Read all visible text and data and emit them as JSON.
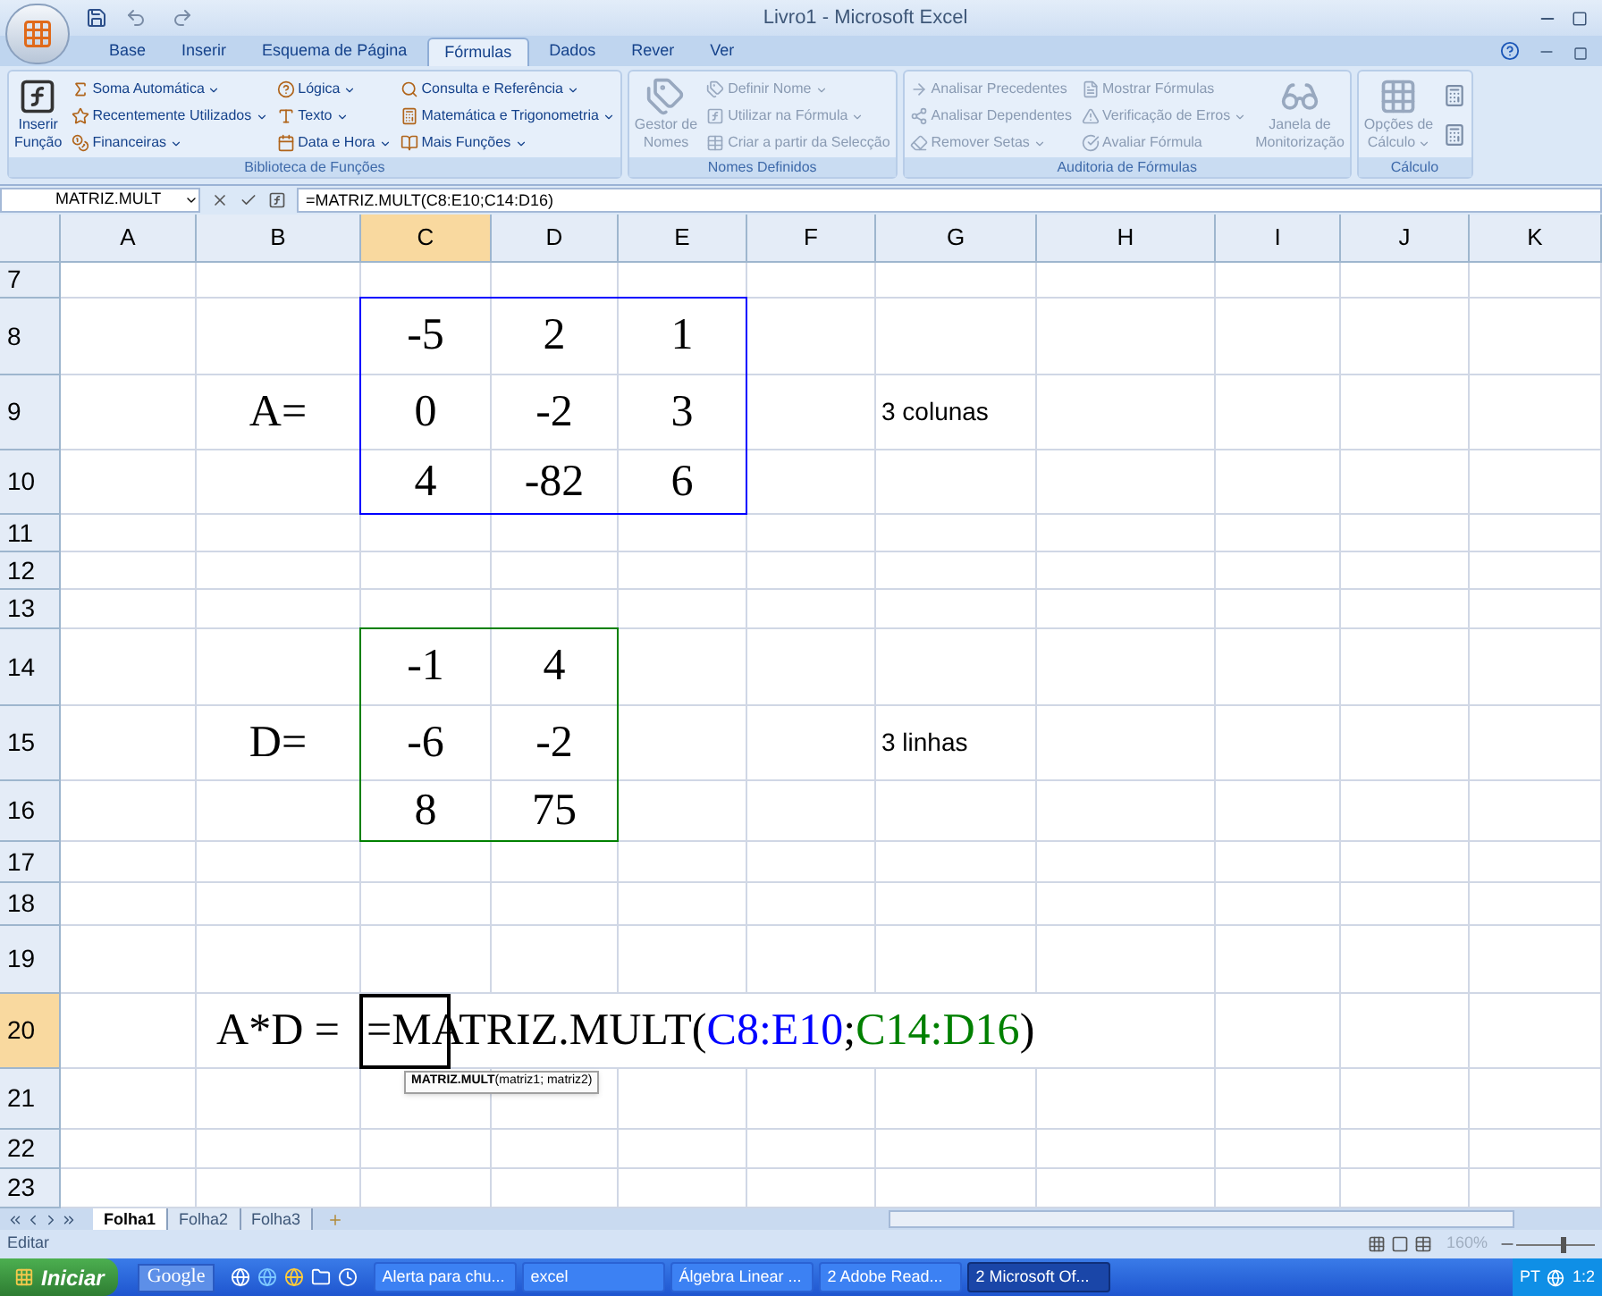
{
  "window": {
    "title": "Livro1 - Microsoft Excel"
  },
  "ribbon_tabs": [
    {
      "label": "Base",
      "selected": false
    },
    {
      "label": "Inserir",
      "selected": false
    },
    {
      "label": "Esquema de Página",
      "selected": false
    },
    {
      "label": "Fórmulas",
      "selected": true
    },
    {
      "label": "Dados",
      "selected": false
    },
    {
      "label": "Rever",
      "selected": false
    },
    {
      "label": "Ver",
      "selected": false
    }
  ],
  "ribbon_groups": [
    {
      "label": "Biblioteca de Funções",
      "disabled": false,
      "columns": [
        [
          {
            "kind": "large",
            "lines": [
              "Inserir",
              "Função"
            ],
            "dropdown": false
          }
        ],
        [
          {
            "kind": "small",
            "label": "Soma Automática",
            "dropdown": true
          },
          {
            "kind": "small",
            "label": "Recentemente Utilizados",
            "dropdown": true
          },
          {
            "kind": "small",
            "label": "Financeiras",
            "dropdown": true
          }
        ],
        [
          {
            "kind": "small",
            "label": "Lógica",
            "dropdown": true
          },
          {
            "kind": "small",
            "label": "Texto",
            "dropdown": true
          },
          {
            "kind": "small",
            "label": "Data e Hora",
            "dropdown": true
          }
        ],
        [
          {
            "kind": "small",
            "label": "Consulta e Referência",
            "dropdown": true
          },
          {
            "kind": "small",
            "label": "Matemática e Trigonometria",
            "dropdown": true
          },
          {
            "kind": "small",
            "label": "Mais Funções",
            "dropdown": true
          }
        ]
      ]
    },
    {
      "label": "Nomes Definidos",
      "disabled": true,
      "columns": [
        [
          {
            "kind": "large",
            "lines": [
              "Gestor de",
              "Nomes"
            ],
            "dropdown": false
          }
        ],
        [
          {
            "kind": "small",
            "label": "Definir Nome",
            "dropdown": true
          },
          {
            "kind": "small",
            "label": "Utilizar na Fórmula",
            "dropdown": true
          },
          {
            "kind": "small",
            "label": "Criar a partir da Selecção",
            "dropdown": false
          }
        ]
      ]
    },
    {
      "label": "Auditoria de Fórmulas",
      "disabled": true,
      "columns": [
        [
          {
            "kind": "small",
            "label": "Analisar Precedentes",
            "dropdown": false
          },
          {
            "kind": "small",
            "label": "Analisar Dependentes",
            "dropdown": false
          },
          {
            "kind": "small",
            "label": "Remover Setas",
            "dropdown": true
          }
        ],
        [
          {
            "kind": "small",
            "label": "Mostrar Fórmulas",
            "dropdown": false
          },
          {
            "kind": "small",
            "label": "Verificação de Erros",
            "dropdown": true
          },
          {
            "kind": "small",
            "label": "Avaliar Fórmula",
            "dropdown": false
          }
        ],
        [
          {
            "kind": "large",
            "lines": [
              "Janela de",
              "Monitorização"
            ],
            "dropdown": false
          }
        ]
      ]
    },
    {
      "label": "Cálculo",
      "disabled": true,
      "columns": [
        [
          {
            "kind": "large",
            "lines": [
              "Opções de",
              "Cálculo"
            ],
            "dropdown": true
          }
        ],
        [
          {
            "kind": "icon"
          },
          {
            "kind": "icon"
          }
        ]
      ]
    }
  ],
  "formula_bar": {
    "name_box": "MATRIZ.MULT",
    "formula": "=MATRIZ.MULT(C8:E10;C14:D16)"
  },
  "columns": [
    {
      "label": "A",
      "selected": false
    },
    {
      "label": "B",
      "selected": false
    },
    {
      "label": "C",
      "selected": true
    },
    {
      "label": "D",
      "selected": false
    },
    {
      "label": "E",
      "selected": false
    },
    {
      "label": "F",
      "selected": false
    },
    {
      "label": "G",
      "selected": false
    },
    {
      "label": "H",
      "selected": false
    },
    {
      "label": "I",
      "selected": false
    },
    {
      "label": "J",
      "selected": false
    },
    {
      "label": "K",
      "selected": false
    }
  ],
  "rows": [
    {
      "label": "7",
      "selected": false,
      "cells": {}
    },
    {
      "label": "8",
      "selected": false,
      "cells": {
        "C": {
          "text": "-5",
          "kind": "math"
        },
        "D": {
          "text": "2",
          "kind": "math"
        },
        "E": {
          "text": "1",
          "kind": "math"
        }
      }
    },
    {
      "label": "9",
      "selected": false,
      "cells": {
        "B": {
          "text": "A=",
          "kind": "math"
        },
        "C": {
          "text": "0",
          "kind": "math"
        },
        "D": {
          "text": "-2",
          "kind": "math"
        },
        "E": {
          "text": "3",
          "kind": "math"
        },
        "G": {
          "text": "3 colunas",
          "kind": "note"
        }
      }
    },
    {
      "label": "10",
      "selected": false,
      "cells": {
        "C": {
          "text": "4",
          "kind": "math"
        },
        "D": {
          "text": "-82",
          "kind": "math"
        },
        "E": {
          "text": "6",
          "kind": "math"
        }
      }
    },
    {
      "label": "11",
      "selected": false,
      "cells": {}
    },
    {
      "label": "12",
      "selected": false,
      "cells": {}
    },
    {
      "label": "13",
      "selected": false,
      "cells": {}
    },
    {
      "label": "14",
      "selected": false,
      "cells": {
        "C": {
          "text": "-1",
          "kind": "math"
        },
        "D": {
          "text": "4",
          "kind": "math"
        }
      }
    },
    {
      "label": "15",
      "selected": false,
      "cells": {
        "B": {
          "text": "D=",
          "kind": "math"
        },
        "C": {
          "text": "-6",
          "kind": "math"
        },
        "D": {
          "text": "-2",
          "kind": "math"
        },
        "G": {
          "text": "3 linhas",
          "kind": "note"
        }
      }
    },
    {
      "label": "16",
      "selected": false,
      "cells": {
        "C": {
          "text": "8",
          "kind": "math"
        },
        "D": {
          "text": "75",
          "kind": "math"
        }
      }
    },
    {
      "label": "17",
      "selected": false,
      "cells": {}
    },
    {
      "label": "18",
      "selected": false,
      "cells": {}
    },
    {
      "label": "19",
      "selected": false,
      "cells": {}
    },
    {
      "label": "20",
      "selected": true,
      "cells": {
        "B": {
          "text": "A*D =",
          "kind": "math"
        }
      }
    },
    {
      "label": "21",
      "selected": false,
      "cells": {}
    },
    {
      "label": "22",
      "selected": false,
      "cells": {}
    },
    {
      "label": "23",
      "selected": false,
      "cells": {}
    }
  ],
  "range_highlights": [
    {
      "color": "#0000ff"
    },
    {
      "color": "#008000"
    }
  ],
  "editing_cell": {
    "parts": [
      {
        "text": "=MATRIZ.MULT(",
        "color": "#000000"
      },
      {
        "text": "C8:E10",
        "color": "#0000ff"
      },
      {
        "text": ";",
        "color": "#000000"
      },
      {
        "text": "C14:D16",
        "color": "#008000"
      },
      {
        "text": ")",
        "color": "#000000"
      }
    ],
    "tooltip": "**MATRIZ.MULT**(matriz1; matriz2)"
  },
  "sheet_tabs": [
    {
      "label": "Folha1",
      "selected": true
    },
    {
      "label": "Folha2",
      "selected": false
    },
    {
      "label": "Folha3",
      "selected": false
    }
  ],
  "status_bar": {
    "mode": "Editar",
    "zoom": "160%",
    "zoom_slider": {
      "level": 0.6
    }
  },
  "taskbar": {
    "start": "Iniciar",
    "search": "Google",
    "tasks": [
      {
        "label": "Alerta para chu...",
        "selected": false
      },
      {
        "label": "excel",
        "selected": false
      },
      {
        "label": "Álgebra Linear ...",
        "selected": false
      },
      {
        "label": "2 Adobe Read...",
        "selected": false
      },
      {
        "label": "2 Microsoft Of...",
        "selected": true
      }
    ],
    "language": "PT",
    "clock": "1:2"
  }
}
